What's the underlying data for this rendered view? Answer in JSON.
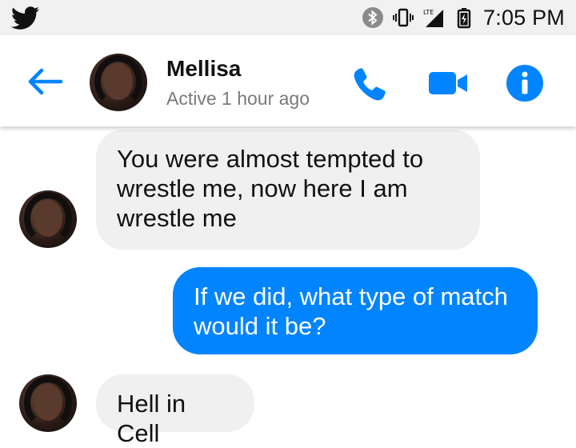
{
  "status_bar": {
    "app_icon": "bird-icon",
    "icons": [
      "bluetooth-icon",
      "vibrate-icon",
      "lte-signal-icon",
      "battery-icon"
    ],
    "lte_label": "LTE",
    "time": "7:05 PM"
  },
  "header": {
    "contact_name": "Mellisa",
    "contact_status": "Active 1 hour ago",
    "icons": [
      "back-arrow-icon",
      "phone-icon",
      "video-camera-icon",
      "info-icon"
    ]
  },
  "messages": [
    {
      "direction": "incoming",
      "text": "You were almost tempted to wrestle me, now here I am wrestle me"
    },
    {
      "direction": "outgoing",
      "text": "If we did, what type of match would it be?"
    },
    {
      "direction": "incoming",
      "text": "Hell in Cell"
    }
  ],
  "colors": {
    "accent": "#0084ff",
    "incoming_bubble": "#f1f0f0",
    "outgoing_bubble": "#0084ff",
    "status_bar": "#f1f1f1"
  }
}
